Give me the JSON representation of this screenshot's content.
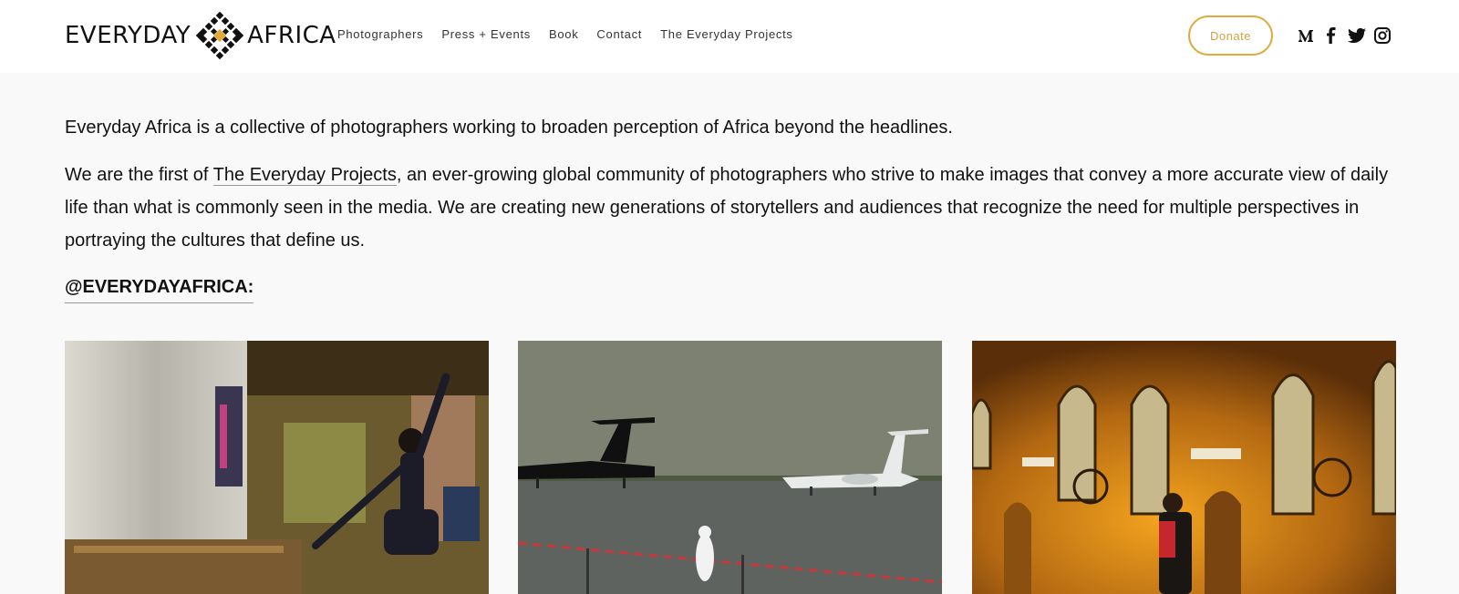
{
  "header": {
    "logo_left": "EVERYDAY",
    "logo_right": "AFRICA",
    "nav": [
      "Photographers",
      "Press + Events",
      "Book",
      "Contact",
      "The Everyday Projects"
    ],
    "donate_label": "Donate",
    "social_icons": [
      "medium-icon",
      "facebook-icon",
      "twitter-icon",
      "instagram-icon"
    ],
    "accent_color": "#e0a93b"
  },
  "intro": {
    "p1": "Everyday Africa is a collective of photographers working to broaden perception of Africa beyond the headlines.",
    "p2_before": "We are the first of ",
    "p2_link": "The Everyday Projects",
    "p2_after": ", an ever-growing global community of photographers who strive to make images that convey a more accurate view of daily life than what is commonly seen in the media. We are creating new generations of storytellers and audiences that recognize the need for multiple perspectives in portraying the cultures that define us.",
    "handle": "@EVERYDAYAFRICA:"
  }
}
